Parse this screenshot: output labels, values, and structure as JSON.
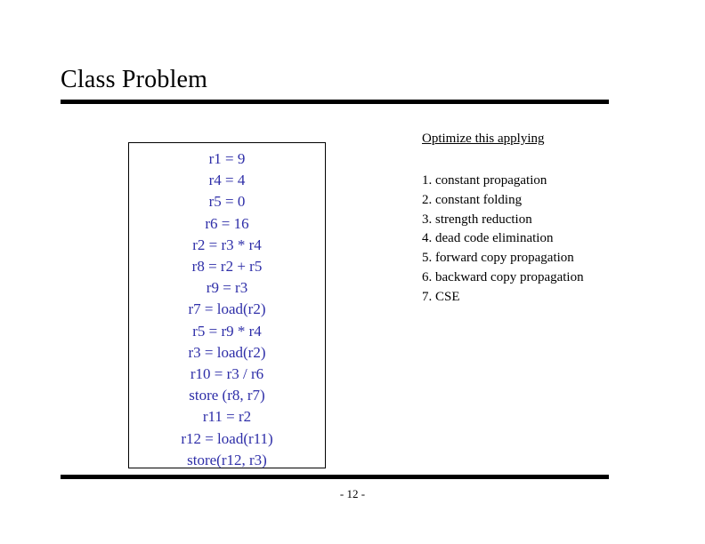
{
  "slide": {
    "title": "Class Problem",
    "page_number": "- 12 -",
    "code_block": {
      "lines": [
        "r1 = 9",
        "r4 = 4",
        "r5 = 0",
        "r6 = 16",
        "r2 = r3 * r4",
        "r8 = r2 + r5",
        "r9 = r3",
        "r7 = load(r2)",
        "r5 = r9 * r4",
        "r3 = load(r2)",
        "r10 = r3 / r6",
        "store (r8, r7)",
        "r11 = r2",
        "r12 = load(r11)",
        "store(r12, r3)"
      ],
      "text_color": "#2e2ea8"
    },
    "instructions": {
      "heading": "Optimize this applying",
      "items": [
        "1. constant propagation",
        "2. constant folding",
        "3. strength reduction",
        "4. dead code elimination",
        "5. forward copy propagation",
        "6. backward copy propagation",
        "7. CSE"
      ]
    }
  }
}
